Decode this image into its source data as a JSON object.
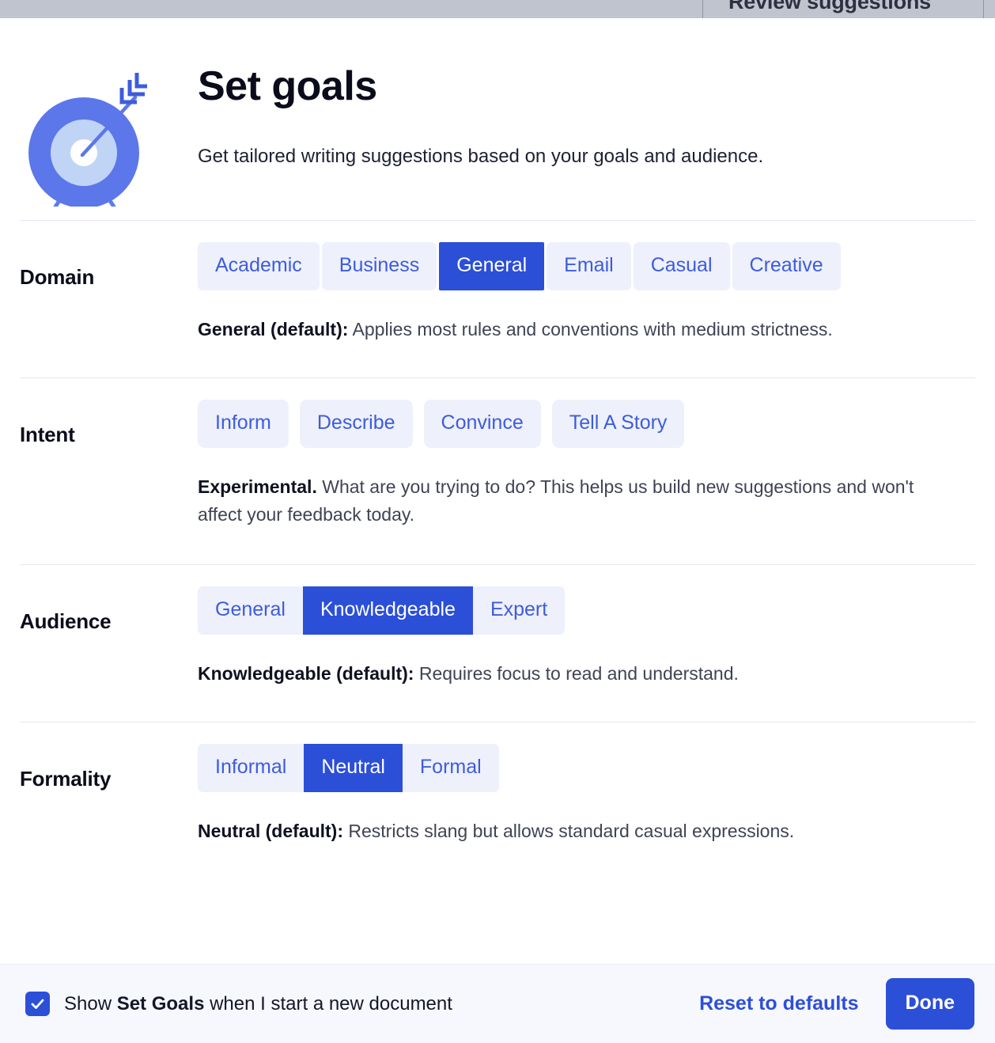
{
  "topbar": {
    "title": "Review suggestions"
  },
  "header": {
    "icon": "target-goal-icon",
    "title": "Set goals",
    "subtitle": "Get tailored writing suggestions based on your goals and audience."
  },
  "sections": [
    {
      "key": "domain",
      "label": "Domain",
      "options": [
        "Academic",
        "Business",
        "General",
        "Email",
        "Casual",
        "Creative"
      ],
      "selected": "General",
      "hint_bold": "General (default):",
      "hint_rest": " Applies most rules and conventions with medium strictness."
    },
    {
      "key": "intent",
      "label": "Intent",
      "options": [
        "Inform",
        "Describe",
        "Convince",
        "Tell A Story"
      ],
      "selected": "",
      "hint_bold": "Experimental.",
      "hint_rest": " What are you trying to do? This helps us build new suggestions and won't affect your feedback today."
    },
    {
      "key": "audience",
      "label": "Audience",
      "options": [
        "General",
        "Knowledgeable",
        "Expert"
      ],
      "selected": "Knowledgeable",
      "hint_bold": "Knowledgeable (default):",
      "hint_rest": " Requires focus to read and understand."
    },
    {
      "key": "formality",
      "label": "Formality",
      "options": [
        "Informal",
        "Neutral",
        "Formal"
      ],
      "selected": "Neutral",
      "hint_bold": "Neutral (default):",
      "hint_rest": " Restricts slang but allows standard casual expressions."
    }
  ],
  "footer": {
    "checkbox_checked": true,
    "checkbox_icon": "checkmark-icon",
    "checkbox_label_pre": "Show ",
    "checkbox_label_bold": "Set Goals",
    "checkbox_label_post": " when I start a new document",
    "reset_label": "Reset to defaults",
    "done_label": "Done"
  },
  "colors": {
    "accent": "#2c4fd8",
    "option_bg": "#eef0fb",
    "option_text": "#3d5cde",
    "footer_bg": "#f7f8fd",
    "divider": "#e4e7ef",
    "topbar_bg": "#bfc4ce"
  }
}
